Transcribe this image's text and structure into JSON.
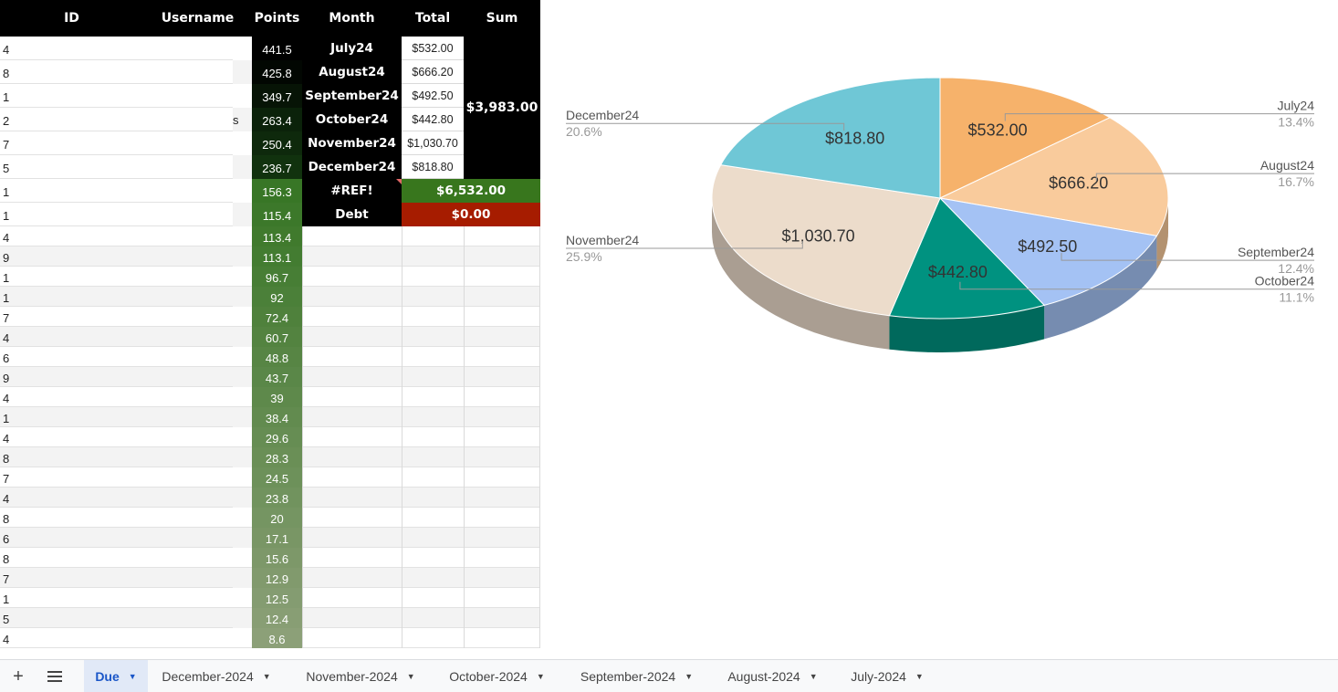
{
  "sheet": {
    "headers": {
      "id": "ID",
      "username": "Username",
      "points": "Points",
      "month": "Month",
      "total": "Total",
      "sum": "Sum"
    },
    "rows": [
      {
        "id": "4",
        "points": "441.5"
      },
      {
        "id": "8",
        "points": "425.8"
      },
      {
        "id": "1",
        "points": "349.7"
      },
      {
        "id": "2",
        "username_frag": "s",
        "points": "263.4"
      },
      {
        "id": "7",
        "points": "250.4"
      },
      {
        "id": "5",
        "points": "236.7"
      },
      {
        "id": "1",
        "points": "156.3"
      },
      {
        "id": "1",
        "points": "115.4"
      },
      {
        "id": "4",
        "points": "113.4"
      },
      {
        "id": "9",
        "points": "113.1"
      },
      {
        "id": "1",
        "points": "96.7"
      },
      {
        "id": "1",
        "points": "92"
      },
      {
        "id": "7",
        "points": "72.4"
      },
      {
        "id": "4",
        "points": "60.7"
      },
      {
        "id": "6",
        "points": "48.8"
      },
      {
        "id": "9",
        "points": "43.7"
      },
      {
        "id": "4",
        "points": "39"
      },
      {
        "id": "1",
        "points": "38.4"
      },
      {
        "id": "4",
        "points": "29.6"
      },
      {
        "id": "8",
        "points": "28.3"
      },
      {
        "id": "7",
        "points": "24.5"
      },
      {
        "id": "4",
        "points": "23.8"
      },
      {
        "id": "8",
        "points": "20"
      },
      {
        "id": "6",
        "points": "17.1"
      },
      {
        "id": "8",
        "points": "15.6"
      },
      {
        "id": "7",
        "points": "12.9"
      },
      {
        "id": "1",
        "points": "12.5"
      },
      {
        "id": "5",
        "points": "12.4"
      },
      {
        "id": "4",
        "points": "8.6"
      }
    ],
    "months": [
      {
        "month": "July24",
        "total": "$532.00"
      },
      {
        "month": "August24",
        "total": "$666.20"
      },
      {
        "month": "September24",
        "total": "$492.50"
      },
      {
        "month": "October24",
        "total": "$442.80"
      },
      {
        "month": "November24",
        "total": "$1,030.70"
      },
      {
        "month": "December24",
        "total": "$818.80"
      }
    ],
    "sum_value": "$3,983.00",
    "ref_label": "#REF!",
    "ref_value": "$6,532.00",
    "debt_label": "Debt",
    "debt_value": "$0.00",
    "colors": {
      "header": "#000000",
      "ref_green": "#38761d",
      "debt_red": "#a61c00",
      "points_dark": "#000000",
      "points_green": "#6aa84f"
    }
  },
  "chart_data": {
    "type": "pie",
    "title": "",
    "slices": [
      {
        "label": "July24",
        "value": 532.0,
        "value_label": "$532.00",
        "percent": "13.4%",
        "color": "#f6b26b"
      },
      {
        "label": "August24",
        "value": 666.2,
        "value_label": "$666.20",
        "percent": "16.7%",
        "color": "#f9cb9c"
      },
      {
        "label": "September24",
        "value": 492.5,
        "value_label": "$492.50",
        "percent": "12.4%",
        "color": "#a4c2f4"
      },
      {
        "label": "October24",
        "value": 442.8,
        "value_label": "$442.80",
        "percent": "11.1%",
        "color": "#009280"
      },
      {
        "label": "November24",
        "value": 1030.7,
        "value_label": "$1,030.70",
        "percent": "25.9%",
        "color": "#ecdccb"
      },
      {
        "label": "December24",
        "value": 818.8,
        "value_label": "$818.80",
        "percent": "20.6%",
        "color": "#6fc7d6"
      }
    ],
    "style": "3d",
    "legend": "callout-labels"
  },
  "tabs": {
    "add_icon": "plus-icon",
    "menu_icon": "hamburger-icon",
    "items": [
      {
        "label": "Due",
        "active": true
      },
      {
        "label": "December-2024",
        "active": false
      },
      {
        "label": "November-2024",
        "active": false
      },
      {
        "label": "October-2024",
        "active": false
      },
      {
        "label": "September-2024",
        "active": false
      },
      {
        "label": "August-2024",
        "active": false
      },
      {
        "label": "July-2024",
        "active": false
      }
    ]
  }
}
